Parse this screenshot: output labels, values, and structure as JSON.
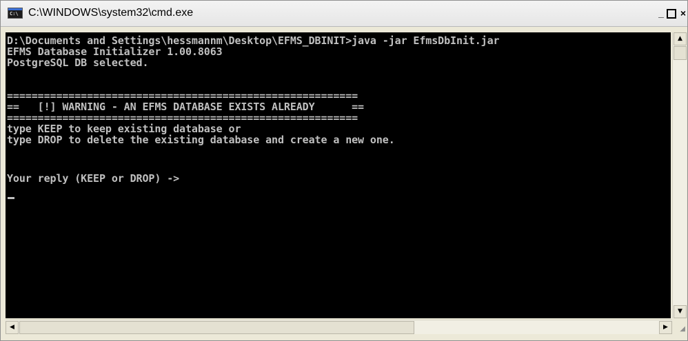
{
  "window": {
    "title": "C:\\WINDOWS\\system32\\cmd.exe",
    "icon_text": "C:\\",
    "controls": {
      "minimize": "_",
      "maximize": "",
      "close": "×"
    }
  },
  "console": {
    "lines": [
      "D:\\Documents and Settings\\hessmannm\\Desktop\\EFMS_DBINIT>java -jar EfmsDbInit.jar",
      "EFMS Database Initializer 1.00.8063",
      "PostgreSQL DB selected.",
      "",
      "=========================================================",
      "==   [!] WARNING - AN EFMS DATABASE EXISTS ALREADY      ==",
      "=========================================================",
      "type KEEP to keep existing database or",
      "type DROP to delete the existing database and create a new one.",
      "",
      "Your reply (KEEP or DROP) ->"
    ]
  },
  "scrollbars": {
    "up_arrow": "▲",
    "down_arrow": "▼",
    "left_arrow": "◀",
    "right_arrow": "▶"
  },
  "colors": {
    "console_bg": "#000000",
    "console_text": "#c0c0c0",
    "title_bar": "#ece9d8"
  }
}
